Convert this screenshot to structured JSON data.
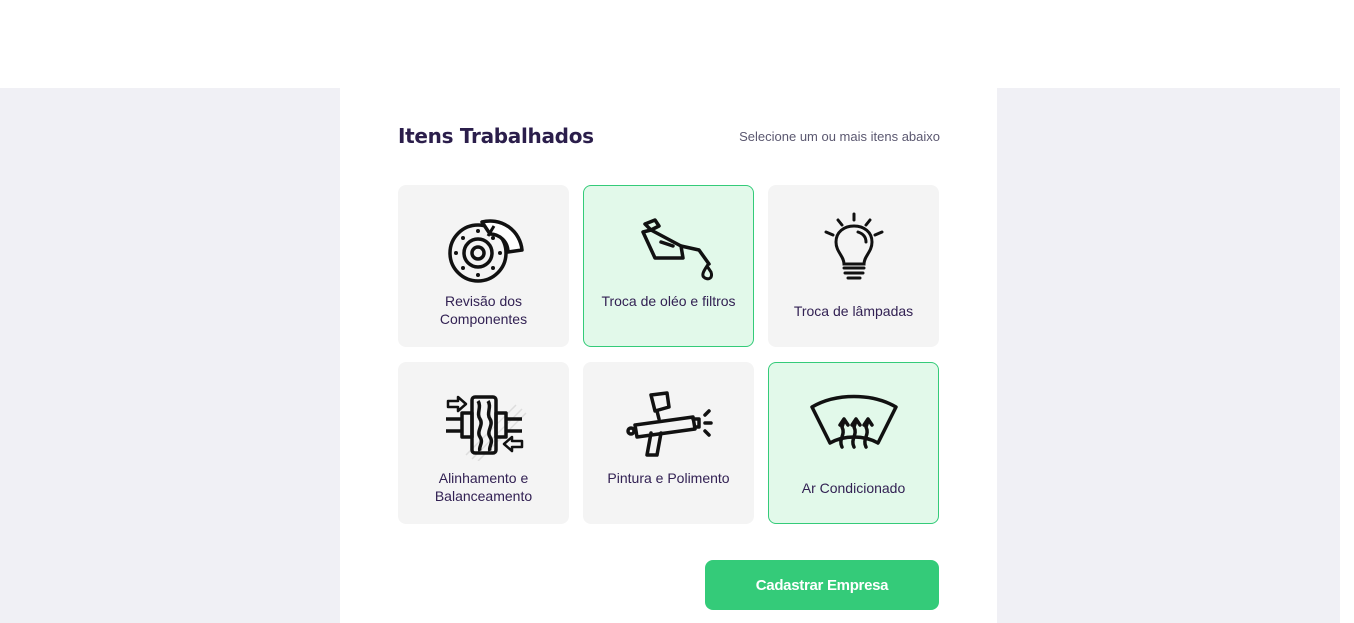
{
  "section": {
    "title": "Itens Trabalhados",
    "hint": "Selecione um ou mais itens abaixo"
  },
  "items": [
    {
      "label": "Revisão dos Componentes",
      "icon": "brake-disc-icon",
      "selected": false
    },
    {
      "label": "Troca de oléo e filtros",
      "icon": "oil-can-icon",
      "selected": true
    },
    {
      "label": "Troca de lâmpadas",
      "icon": "light-bulb-icon",
      "selected": false
    },
    {
      "label": "Alinhamento e Balanceamento",
      "icon": "wheel-alignment-icon",
      "selected": false
    },
    {
      "label": "Pintura e Polimento",
      "icon": "spray-gun-icon",
      "selected": false
    },
    {
      "label": "Ar Condicionado",
      "icon": "windshield-defrost-icon",
      "selected": true
    }
  ],
  "submit": {
    "label": "Cadastrar Empresa"
  },
  "colors": {
    "accent": "#34cb79",
    "selected_bg": "#e2f9ea",
    "title": "#2b1e4b",
    "item_bg": "#f4f4f4",
    "page_bg": "#f0f0f5"
  }
}
